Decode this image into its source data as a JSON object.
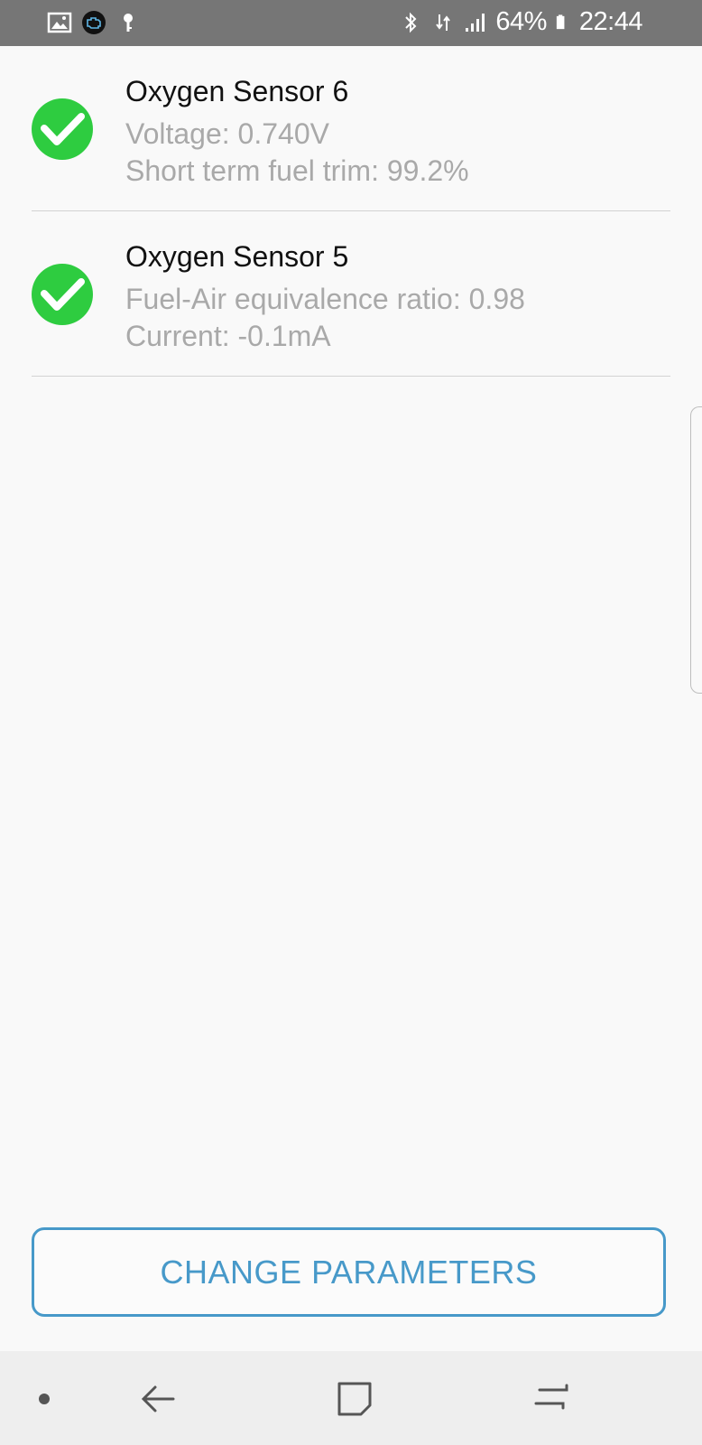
{
  "status_bar": {
    "left_icons": [
      "image-icon",
      "engine-icon",
      "key-icon"
    ],
    "right_icons": [
      "bluetooth-icon",
      "data-transfer-icon",
      "signal-icon"
    ],
    "battery": "64%",
    "time": "22:44"
  },
  "sensors": [
    {
      "title": "Oxygen Sensor 6",
      "line1": "Voltage: 0.740V",
      "line2": "Short term fuel trim: 99.2%",
      "status_icon": "checkmark-circle-icon"
    },
    {
      "title": "Oxygen Sensor 5",
      "line1": "Fuel-Air equivalence ratio: 0.98",
      "line2": "Current: -0.1mA",
      "status_icon": "checkmark-circle-icon"
    }
  ],
  "action": {
    "label": "CHANGE PARAMETERS"
  },
  "nav": {
    "buttons": [
      "dot-icon",
      "back-icon",
      "home-icon",
      "recents-icon"
    ]
  },
  "colors": {
    "accent": "#4799c9",
    "check": "#2ecc40",
    "status_bar": "#767676",
    "background": "#f9f9f9"
  }
}
